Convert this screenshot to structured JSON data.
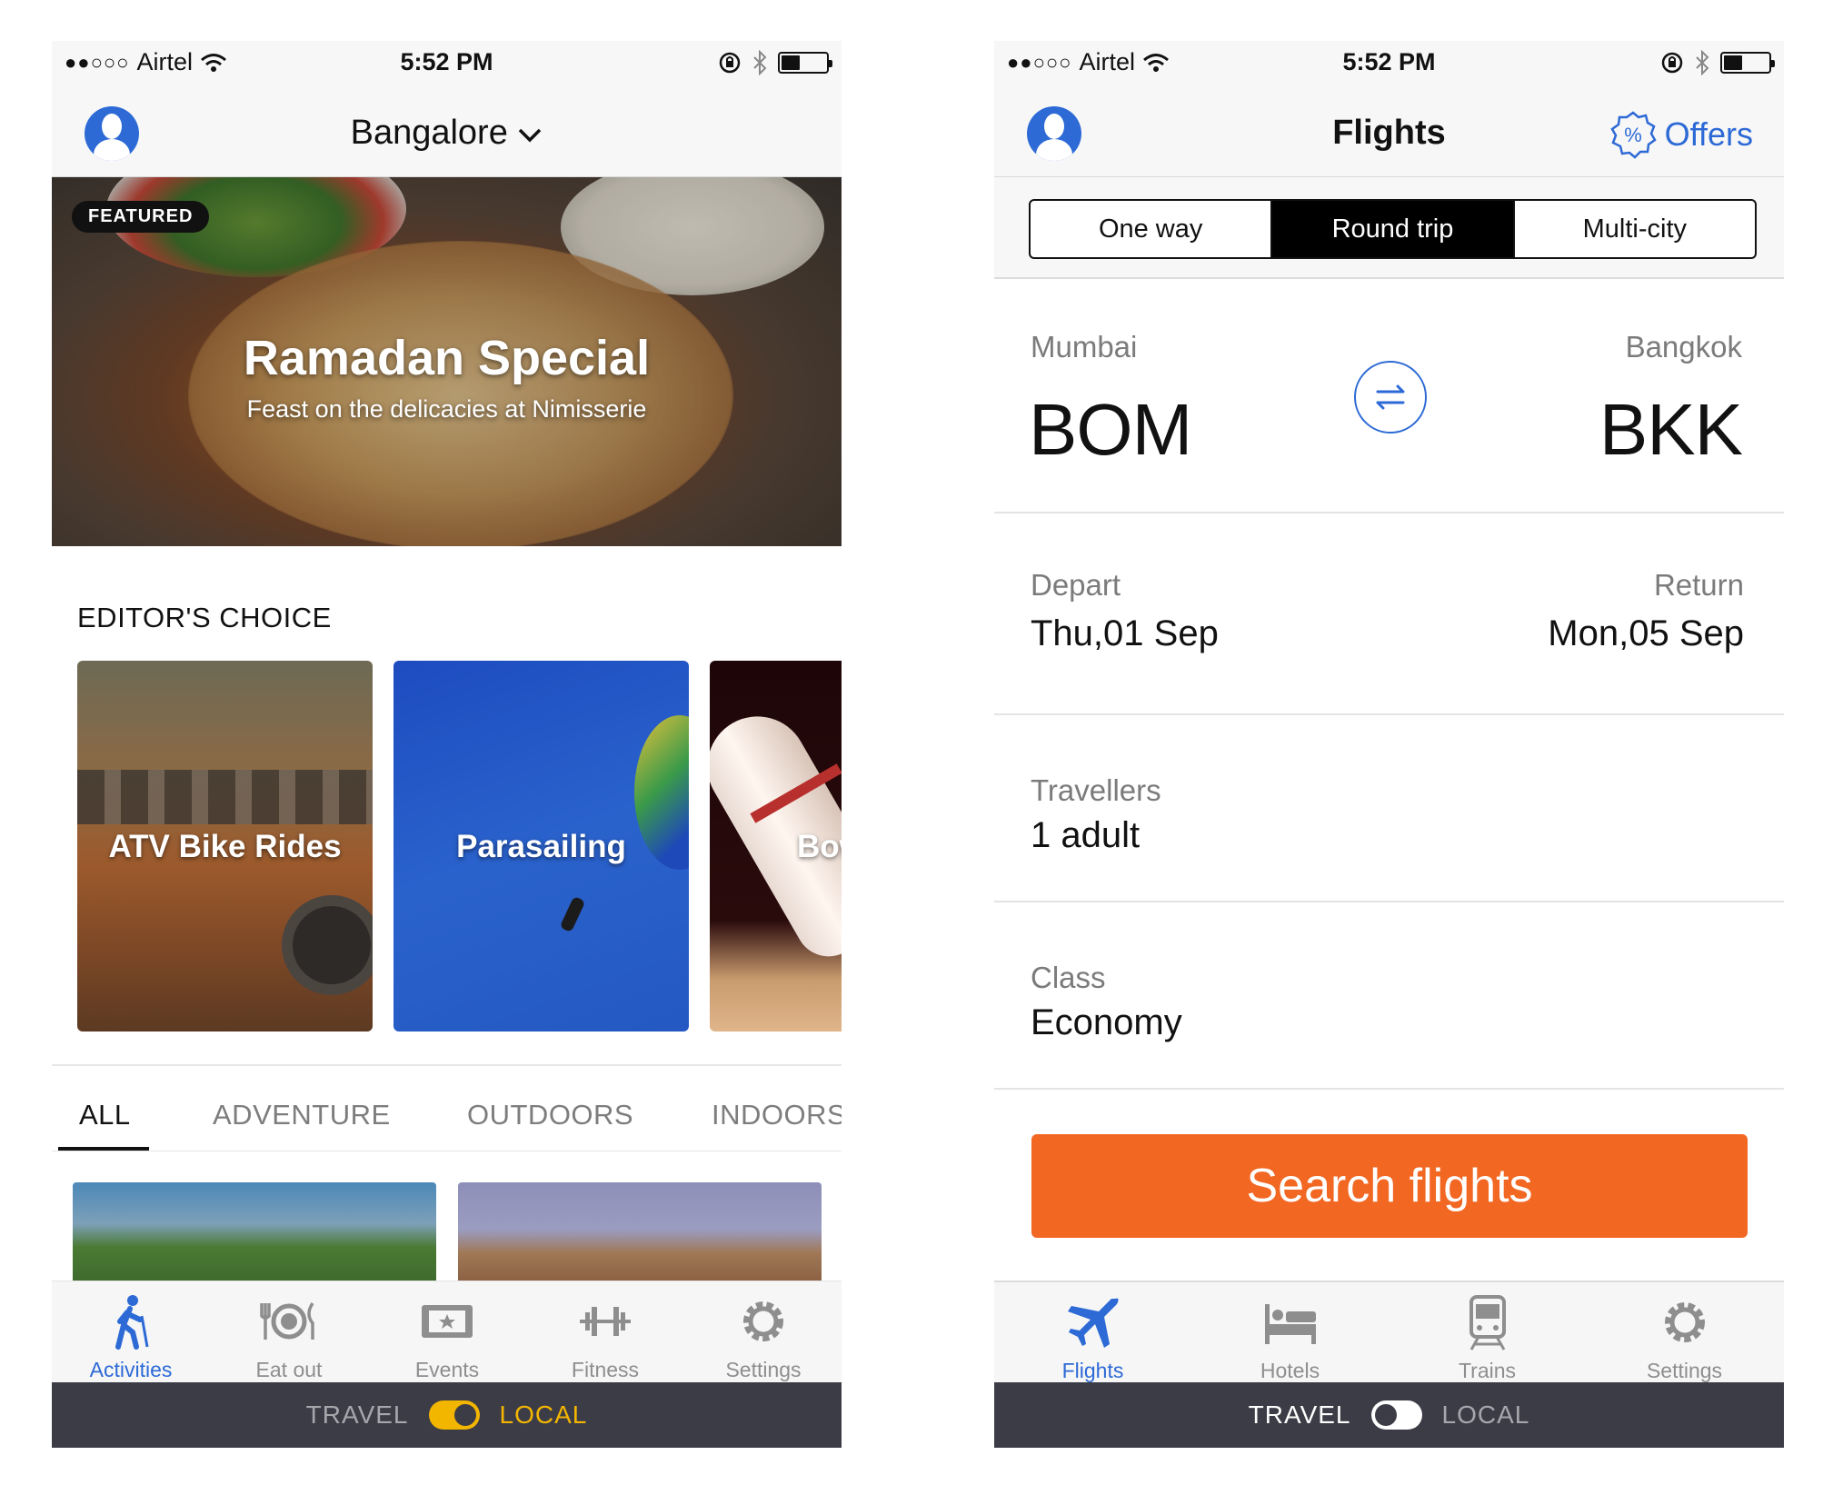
{
  "colors": {
    "accent_blue": "#2d6ad6",
    "search_orange": "#f26722",
    "mode_yellow": "#f2b500",
    "modebar_bg": "#3c3c47"
  },
  "local_screen": {
    "status_bar": {
      "carrier": "Airtel",
      "signal": "●●○○○",
      "time": "5:52 PM"
    },
    "nav": {
      "city": "Bangalore"
    },
    "featured": {
      "badge": "FEATURED",
      "title": "Ramadan Special",
      "subtitle": "Feast on the delicacies at Nimisserie"
    },
    "editors_choice": {
      "title": "EDITOR'S CHOICE",
      "cards": [
        {
          "label": "ATV Bike Rides"
        },
        {
          "label": "Parasailing"
        },
        {
          "label": "Bowling"
        }
      ]
    },
    "categories": [
      "ALL",
      "ADVENTURE",
      "OUTDOORS",
      "INDOORS"
    ],
    "active_category": "ALL",
    "tabbar": [
      {
        "label": "Activities",
        "icon": "hiker-icon",
        "active": true
      },
      {
        "label": "Eat out",
        "icon": "plate-cutlery-icon",
        "active": false
      },
      {
        "label": "Events",
        "icon": "ticket-icon",
        "active": false
      },
      {
        "label": "Fitness",
        "icon": "dumbbell-icon",
        "active": false
      },
      {
        "label": "Settings",
        "icon": "gear-icon",
        "active": false
      }
    ],
    "mode_switch": {
      "left": "TRAVEL",
      "right": "LOCAL",
      "selected": "LOCAL"
    }
  },
  "flights_screen": {
    "status_bar": {
      "carrier": "Airtel",
      "signal": "●●○○○",
      "time": "5:52 PM"
    },
    "nav": {
      "title": "Flights",
      "offers": "Offers"
    },
    "trip_types": [
      "One way",
      "Round trip",
      "Multi-city"
    ],
    "selected_trip_type": "Round trip",
    "route": {
      "from_city": "Mumbai",
      "from_code": "BOM",
      "to_city": "Bangkok",
      "to_code": "BKK"
    },
    "dates": {
      "depart_label": "Depart",
      "depart_value": "Thu,01 Sep",
      "return_label": "Return",
      "return_value": "Mon,05 Sep"
    },
    "travellers": {
      "label": "Travellers",
      "value": "1 adult"
    },
    "class": {
      "label": "Class",
      "value": "Economy"
    },
    "search_button": "Search flights",
    "tabbar": [
      {
        "label": "Flights",
        "icon": "airplane-icon",
        "active": true
      },
      {
        "label": "Hotels",
        "icon": "bed-icon",
        "active": false
      },
      {
        "label": "Trains",
        "icon": "train-icon",
        "active": false
      },
      {
        "label": "Settings",
        "icon": "gear-icon",
        "active": false
      }
    ],
    "mode_switch": {
      "left": "TRAVEL",
      "right": "LOCAL",
      "selected": "TRAVEL"
    }
  }
}
